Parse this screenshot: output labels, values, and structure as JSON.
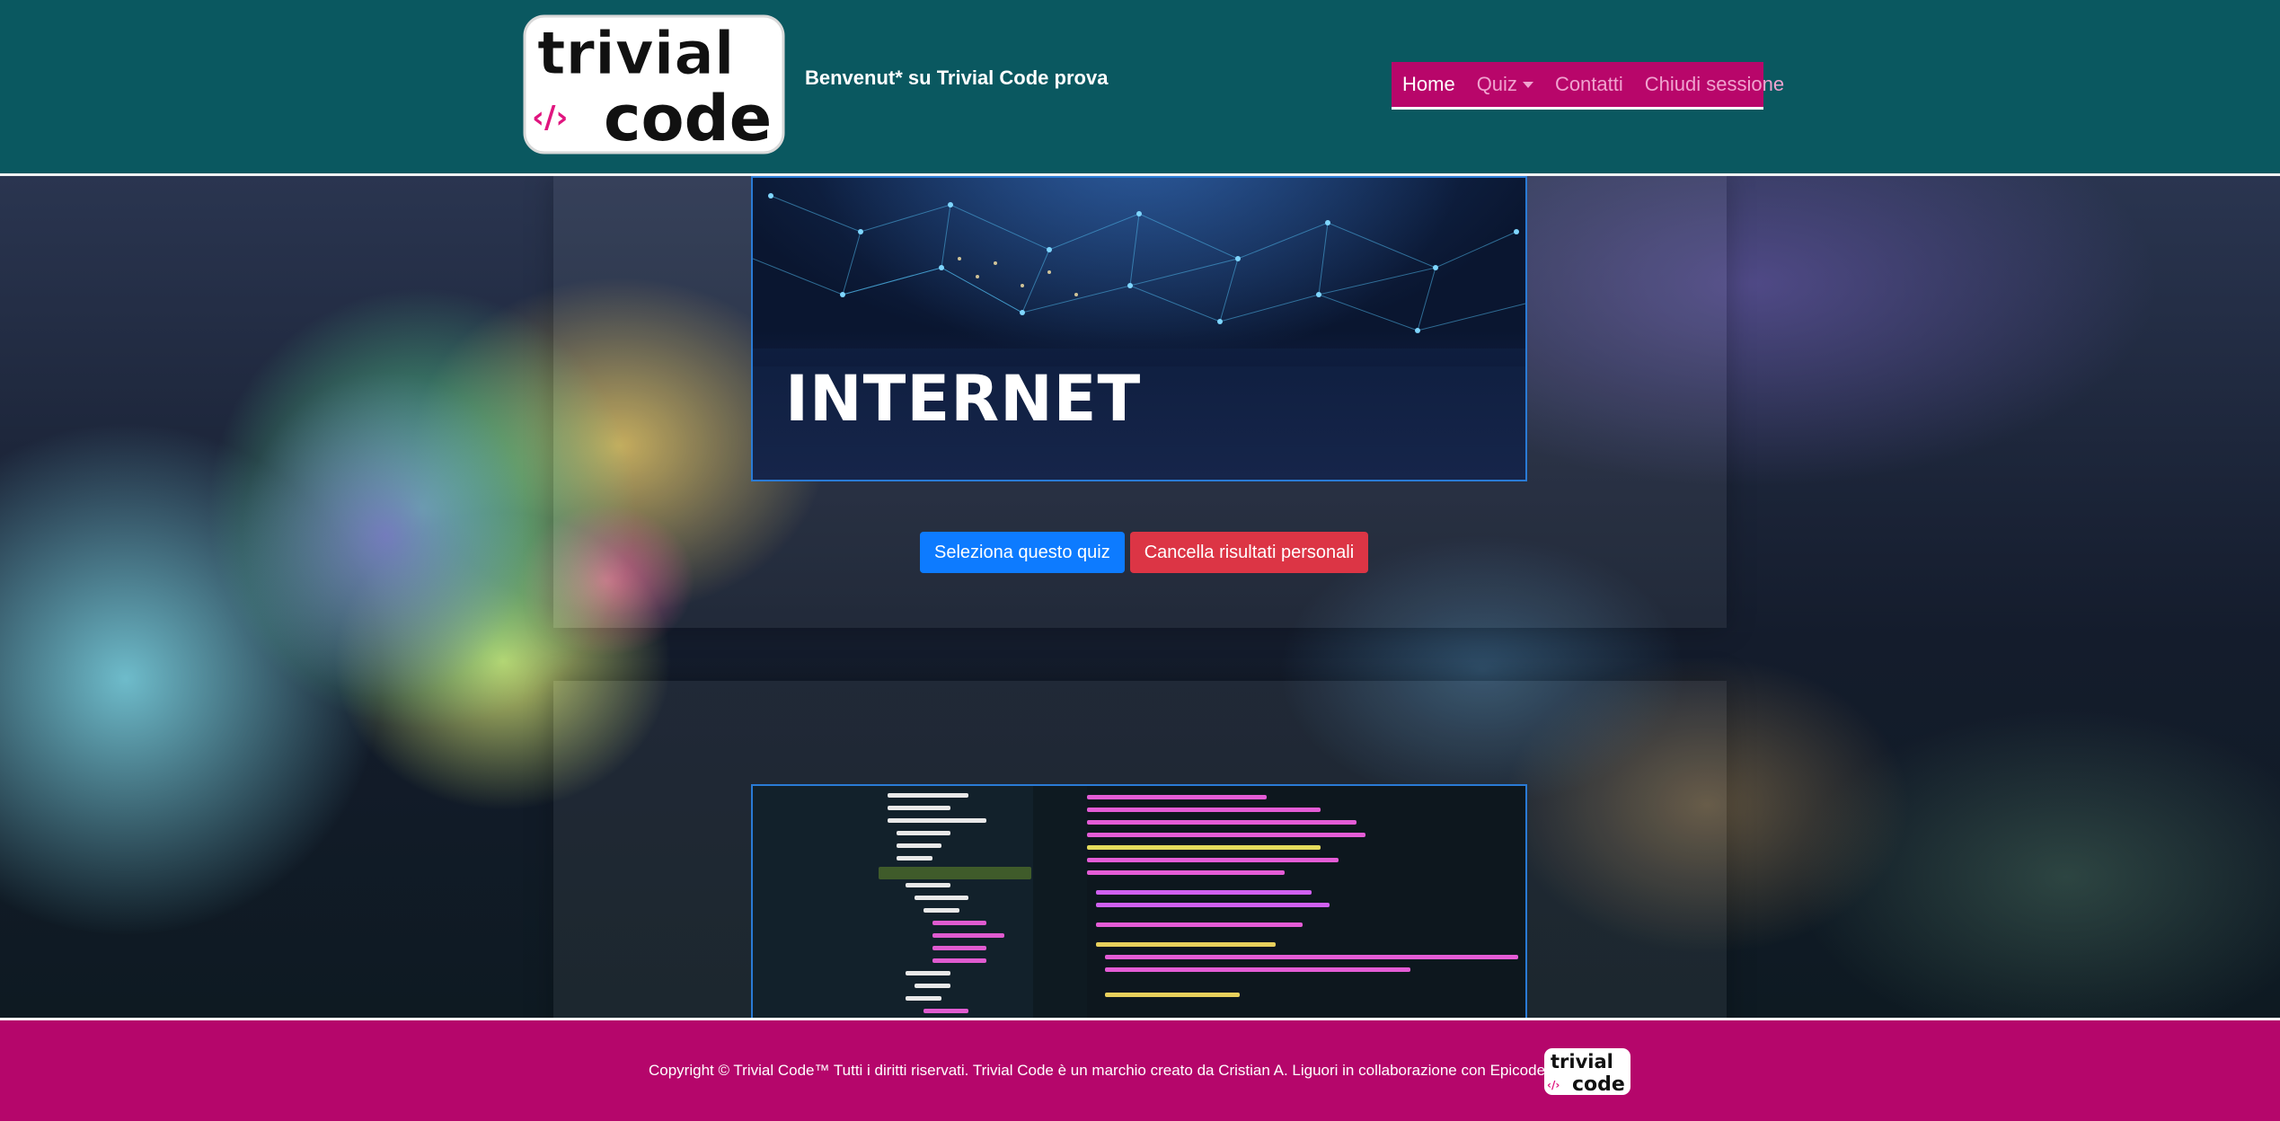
{
  "header": {
    "logo": {
      "line1": "trivial",
      "line2": "code",
      "mark": "‹/›"
    },
    "welcome": "Benvenut* su Trivial Code prova",
    "nav": [
      {
        "label": "Home",
        "active": true
      },
      {
        "label": "Quiz",
        "active": false,
        "dropdown": true
      },
      {
        "label": "Contatti",
        "active": false
      },
      {
        "label": "Chiudi sessione",
        "active": false
      }
    ]
  },
  "quizzes": [
    {
      "image_title": "INTERNET",
      "select_button": "Seleziona questo quiz",
      "delete_button": "Cancella risultati personali"
    }
  ],
  "footer": {
    "copyright": "Copyright © Trivial Code™ Tutti i diritti riservati. Trivial Code è un marchio creato da Cristian A. Liguori in collaborazione con Epicode School."
  },
  "colors": {
    "header_bg": "#0a5860",
    "brand_pink": "#b5066b",
    "primary_button": "#0d7bff",
    "danger_button": "#dc3545"
  }
}
